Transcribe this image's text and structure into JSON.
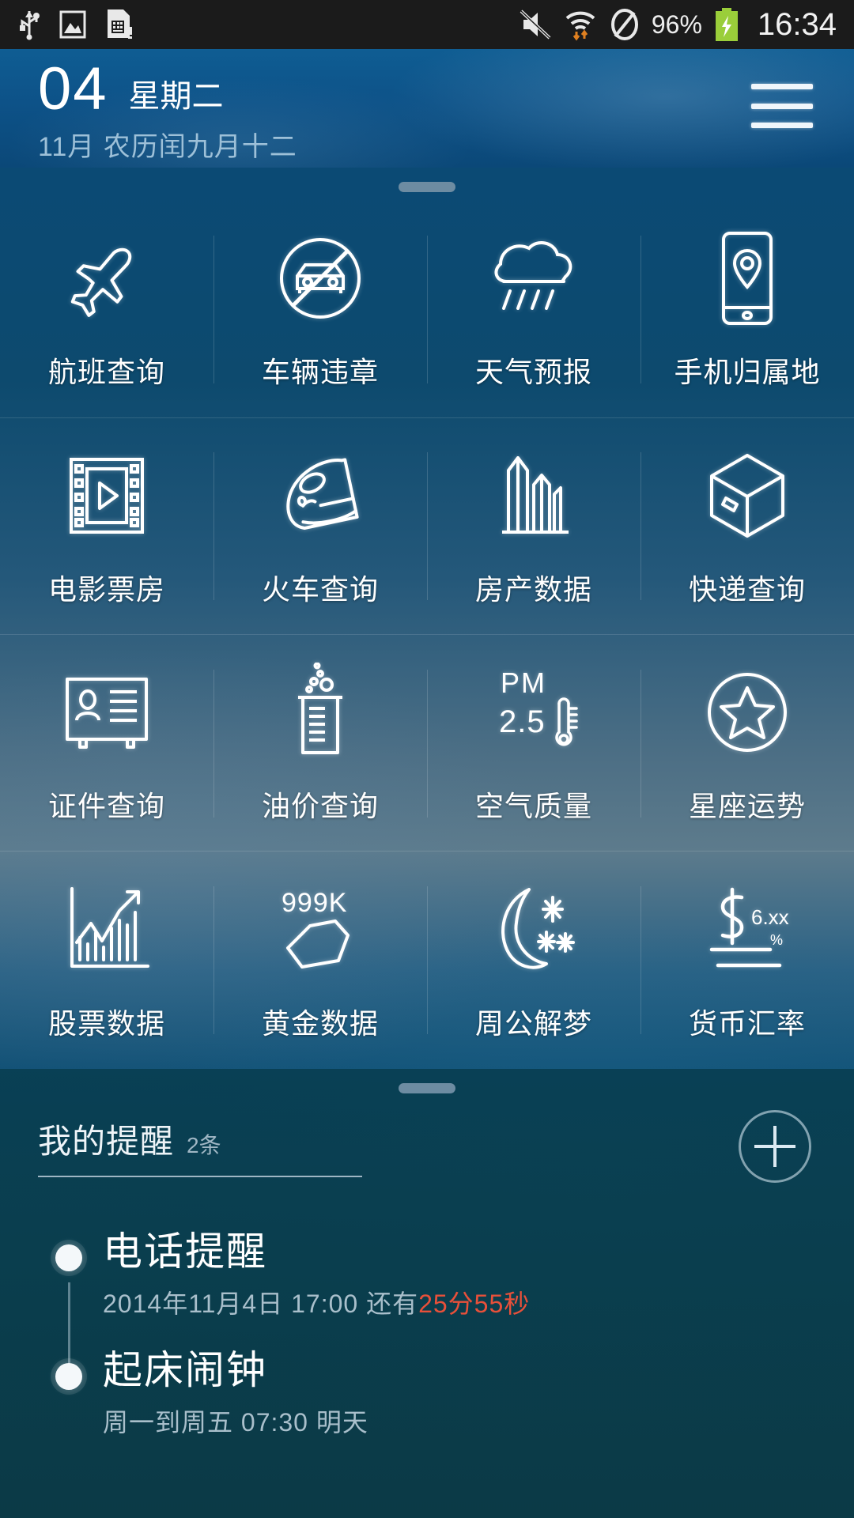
{
  "statusbar": {
    "left_icons": [
      "usb-icon",
      "image-icon",
      "sim-card-icon"
    ],
    "right_icons": [
      "mute-icon",
      "wifi-icon",
      "do-not-disturb-icon"
    ],
    "battery_percent": "96%",
    "battery_icon": "battery-charging-icon",
    "time": "16:34"
  },
  "header": {
    "day": "04",
    "weekday": "星期二",
    "subtitle": "11月 农历闰九月十二",
    "menu_icon": "hamburger-menu-icon"
  },
  "grid": {
    "handle": "drag-handle",
    "items": [
      {
        "label": "航班查询",
        "icon": "airplane-icon"
      },
      {
        "label": "车辆违章",
        "icon": "no-car-icon"
      },
      {
        "label": "天气预报",
        "icon": "rain-cloud-icon"
      },
      {
        "label": "手机归属地",
        "icon": "phone-location-icon"
      },
      {
        "label": "电影票房",
        "icon": "film-strip-icon"
      },
      {
        "label": "火车查询",
        "icon": "train-icon"
      },
      {
        "label": "房产数据",
        "icon": "buildings-icon"
      },
      {
        "label": "快递查询",
        "icon": "package-box-icon"
      },
      {
        "label": "证件查询",
        "icon": "id-card-icon"
      },
      {
        "label": "油价查询",
        "icon": "beaker-icon"
      },
      {
        "label": "空气质量",
        "icon": "pm25-thermometer-icon",
        "icon_text_1": "PM",
        "icon_text_2": "2.5"
      },
      {
        "label": "星座运势",
        "icon": "star-circle-icon"
      },
      {
        "label": "股票数据",
        "icon": "stock-chart-icon"
      },
      {
        "label": "黄金数据",
        "icon": "gold-nugget-icon",
        "icon_text_1": "999K"
      },
      {
        "label": "周公解梦",
        "icon": "moon-stars-icon"
      },
      {
        "label": "货币汇率",
        "icon": "currency-rate-icon",
        "icon_text_1": "6.xx",
        "icon_text_2": "%"
      }
    ]
  },
  "reminders": {
    "handle": "drag-handle",
    "title": "我的提醒",
    "count": "2条",
    "add_icon": "plus-circle-icon",
    "items": [
      {
        "name": "电话提醒",
        "sub_prefix": "2014年11月4日 17:00 还有",
        "sub_highlight": "25分55秒"
      },
      {
        "name": "起床闹钟",
        "sub_prefix": "周一到周五 07:30 明天",
        "sub_highlight": ""
      }
    ]
  },
  "colors": {
    "accent_red": "#e8503a",
    "header_blue": "#0d5288",
    "battery_green": "#9ace3a"
  }
}
